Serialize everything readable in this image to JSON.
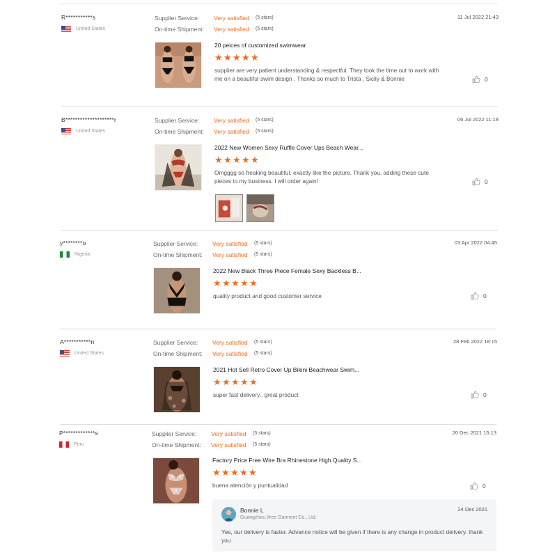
{
  "labels": {
    "supplier_service": "Supplier Service:",
    "ontime_shipment": "On-time Shipment:"
  },
  "reviews": [
    {
      "buyer": "R***********s",
      "country": "United States",
      "flag": "us",
      "supplier_rating": "Very satisfied",
      "supplier_stars": "(5 stars)",
      "shipment_rating": "Very satisfied",
      "shipment_stars": "(5 stars)",
      "date": "11 Jul 2022 21:43",
      "product": "20 peices of customized swimwear",
      "product_stars": 5,
      "comment": "supplier are very patient understanding & respectful. They took the time out to work with me on a beautiful swim design . Thsnks so much to Trista , Sicily & Bonnie",
      "likes": "0"
    },
    {
      "buyer": "B********************r",
      "country": "United States",
      "flag": "us",
      "supplier_rating": "Very satisfied",
      "supplier_stars": "(5 stars)",
      "shipment_rating": "Very satisfied",
      "shipment_stars": "(5 stars)",
      "date": "06 Jul 2022 11:18",
      "product": "2022 New Women Sexy Ruffle Cover Ups Beach Wear...",
      "product_stars": 5,
      "comment": "Omgggg so freaking beautiful. exactly like the picture. Thank you, adding these cute pieces to my business. I will order again!",
      "likes": "0"
    },
    {
      "buyer": "y********o",
      "country": "Nigeria",
      "flag": "ng",
      "supplier_rating": "Very satisfied",
      "supplier_stars": "(5 stars)",
      "shipment_rating": "Very satisfied",
      "shipment_stars": "(5 stars)",
      "date": "03 Apr 2022 04:45",
      "product": "2022 New Black Three Piece Female Sexy Backless B...",
      "product_stars": 5,
      "comment": "quality product and good customer service",
      "likes": "0"
    },
    {
      "buyer": "A***********n",
      "country": "United States",
      "flag": "us",
      "supplier_rating": "Very satisfied",
      "supplier_stars": "(5 stars)",
      "shipment_rating": "Very satisfied",
      "shipment_stars": "(5 stars)",
      "date": "28 Feb 2022 18:15",
      "product": "2021 Hot Sell Retro Cover Up Bikini Beachwear Swim...",
      "product_stars": 5,
      "comment": "super fast delivery.. great product",
      "likes": "0"
    },
    {
      "buyer": "P*************s",
      "country": "Peru",
      "flag": "pe",
      "supplier_rating": "Very satisfied",
      "supplier_stars": "(5 stars)",
      "shipment_rating": "Very satisfied",
      "shipment_stars": "(5 stars)",
      "date": "20 Dec 2021 15:13",
      "product": "Factory Price Free Wire Bra Rhinestone High Quality S...",
      "product_stars": 5,
      "comment": "buena atención y puntualidad",
      "likes": "0"
    }
  ],
  "reply": {
    "name": "Bonnie L",
    "company": "Guangzhou Ifree Garment Co., Ltd.",
    "date": "24 Dec 2021",
    "text": "Yes, our delivery is faster. Advance notice will be given if there is any change in product delivery. thank you"
  },
  "colors": {
    "accent": "#f26b1d",
    "divider": "#dcdcdc",
    "reply_bg": "#f4f5f7"
  },
  "icons": {
    "star": "star-icon",
    "like": "thumbs-up-icon"
  }
}
